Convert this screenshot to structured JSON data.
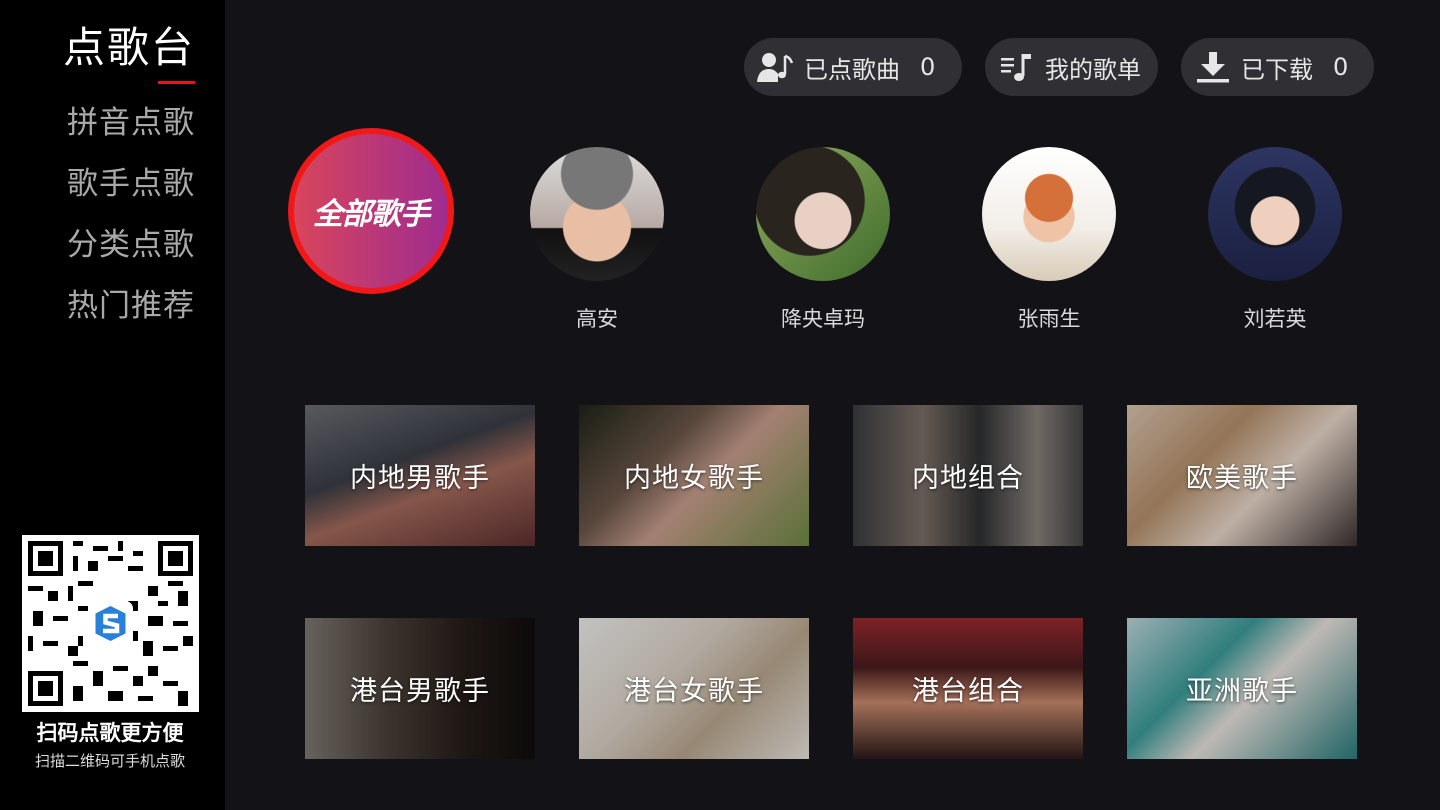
{
  "sidebar": {
    "title": "点歌台",
    "items": [
      {
        "label": "拼音点歌"
      },
      {
        "label": "歌手点歌"
      },
      {
        "label": "分类点歌"
      },
      {
        "label": "热门推荐"
      }
    ],
    "qr": {
      "title": "扫码点歌更方便",
      "subtitle": "扫描二维码可手机点歌"
    }
  },
  "header": {
    "ordered": {
      "label": "已点歌曲",
      "count": "0",
      "icon": "singer-note-icon"
    },
    "playlist": {
      "label": "我的歌单",
      "icon": "playlist-icon"
    },
    "download": {
      "label": "已下载",
      "count": "0",
      "icon": "download-icon"
    }
  },
  "singers": {
    "all_label": "全部歌手",
    "featured": [
      {
        "name": "高安"
      },
      {
        "name": "降央卓玛"
      },
      {
        "name": "张雨生"
      },
      {
        "name": "刘若英"
      }
    ]
  },
  "categories": [
    {
      "label": "内地男歌手"
    },
    {
      "label": "内地女歌手"
    },
    {
      "label": "内地组合"
    },
    {
      "label": "欧美歌手"
    },
    {
      "label": "港台男歌手"
    },
    {
      "label": "港台女歌手"
    },
    {
      "label": "港台组合"
    },
    {
      "label": "亚洲歌手"
    }
  ],
  "colors": {
    "accent": "#e0171c",
    "sidebar_bg": "#000000",
    "main_bg": "#131317",
    "button_bg": "#303034"
  }
}
